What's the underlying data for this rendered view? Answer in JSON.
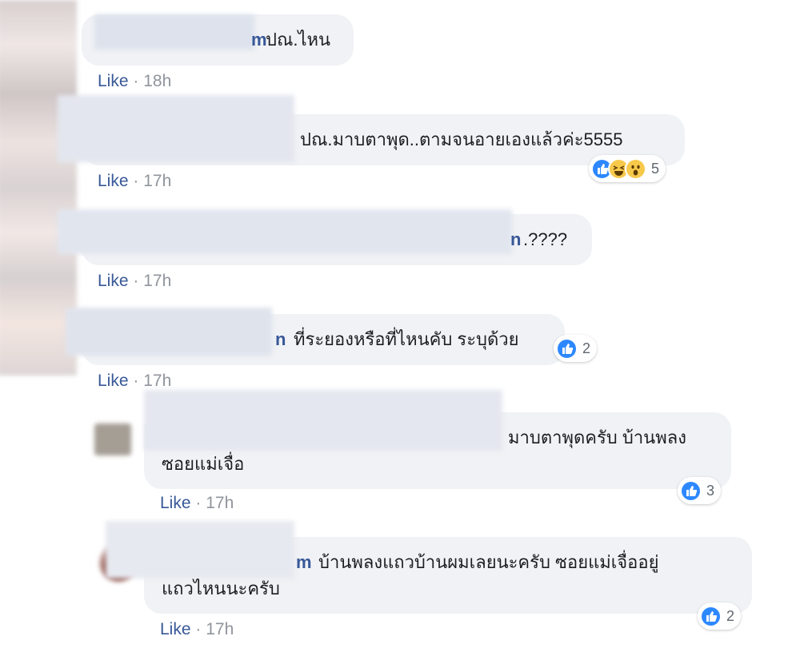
{
  "comments": [
    {
      "name_suffix": "m",
      "text": "ปณ.ไหน",
      "like_label": "Like",
      "time": "18h",
      "reaction_count": ""
    },
    {
      "name_suffix": "",
      "text": "ปณ.มาบตาพุด..ตามจนอายเองแล้วค่ะ5555",
      "like_label": "Like",
      "time": "17h",
      "reaction_count": "5"
    },
    {
      "name_suffix": "n",
      "text": ".????",
      "like_label": "Like",
      "time": "17h",
      "reaction_count": ""
    },
    {
      "name_suffix": "n",
      "text": "ที่ระยองหรือที่ไหนคับ ระบุด้วย",
      "like_label": "Like",
      "time": "17h",
      "reaction_count": "2"
    }
  ],
  "replies": [
    {
      "name_suffix": "",
      "text_line1": "มาบตาพุดครับ บ้านพลง",
      "text_line2": "ซอยแม่เจื่อ",
      "like_label": "Like",
      "time": "17h",
      "reaction_count": "3"
    },
    {
      "name_suffix": "m",
      "text_line1": "บ้านพลงแถวบ้านผมเลยนะครับ ซอยแม่เจื่ออยู่",
      "text_line2": "แถวไหนนะครับ",
      "like_label": "Like",
      "time": "17h",
      "reaction_count": "2"
    }
  ],
  "meta_separator": "·",
  "colors": {
    "bubble": "#f0f2f5",
    "link": "#385898",
    "meta": "#90949c",
    "like_blue": "#2d88ff",
    "emoji_yellow": "#f7c94b"
  }
}
